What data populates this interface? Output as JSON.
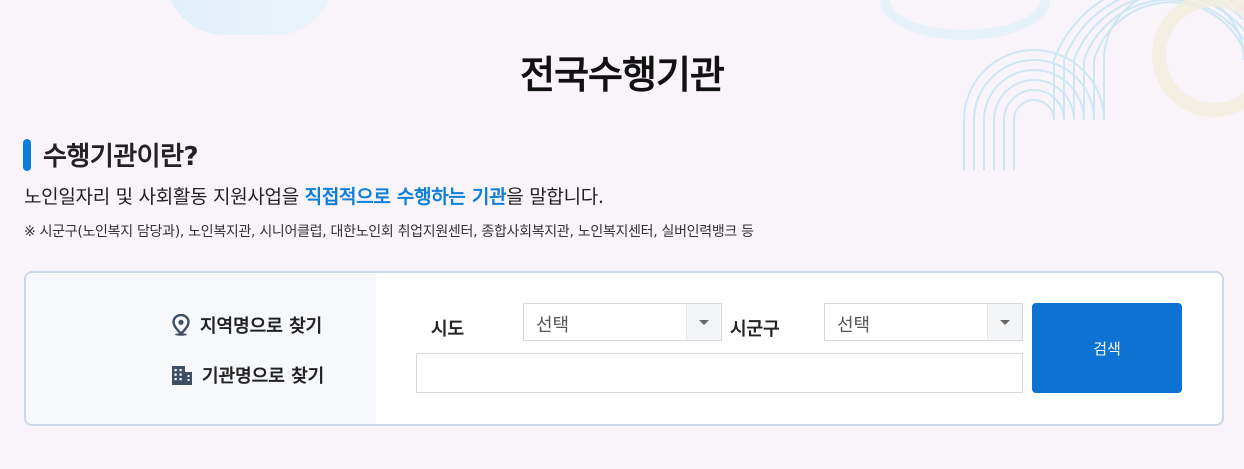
{
  "page": {
    "title": "전국수행기관"
  },
  "section": {
    "title": "수행기관이란?",
    "desc_prefix": "노인일자리 및 사회활동 지원사업을 ",
    "desc_highlight": "직접적으로 수행하는 기관",
    "desc_suffix": "을 말합니다.",
    "note": "※ 시군구(노인복지 담당과), 노인복지관, 시니어클럽, 대한노인회 취업지원센터, 종합사회복지관, 노인복지센터, 실버인력뱅크 등"
  },
  "search": {
    "mode_region_label": "지역명으로 찾기",
    "mode_org_label": "기관명으로 찾기",
    "sido_label": "시도",
    "sido_value": "선택",
    "sigungu_label": "시군구",
    "sigungu_value": "선택",
    "org_input_value": "",
    "button_label": "검색"
  },
  "colors": {
    "accent": "#0d7fd8",
    "button": "#0d73d2",
    "background": "#f8f4fa"
  },
  "icons": {
    "region": "location-pin-icon",
    "org": "building-icon",
    "select": "chevron-down-icon"
  }
}
